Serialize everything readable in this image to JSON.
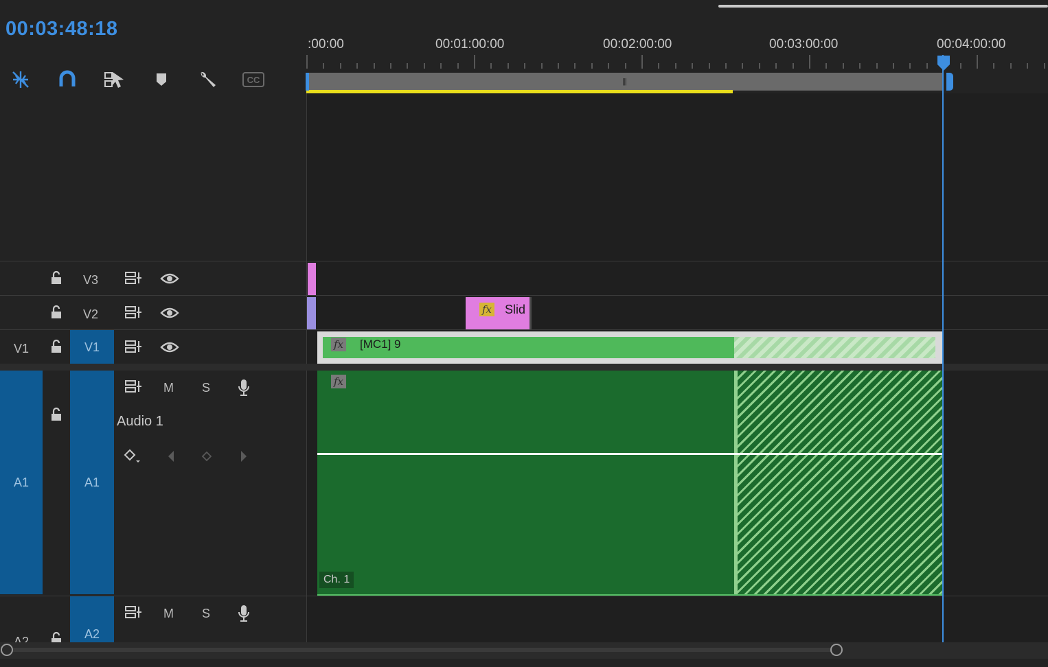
{
  "timecode": "00:03:48:18",
  "ruler": {
    "labels": [
      ":00:00",
      "00:01:00:00",
      "00:02:00:00",
      "00:03:00:00",
      "00:04:00:00"
    ]
  },
  "toolbar": {
    "icons": [
      "nest-sequence-icon",
      "snap-magnet-icon",
      "linked-selection-icon",
      "add-marker-icon",
      "timeline-settings-wrench-icon",
      "captions-cc-icon"
    ],
    "captions_label": "CC"
  },
  "tracks": {
    "v3": {
      "label": "V3"
    },
    "v2": {
      "label": "V2"
    },
    "v1": {
      "source": "V1",
      "label": "V1"
    },
    "a1": {
      "source": "A1",
      "label": "A1",
      "name": "Audio 1",
      "mute": "M",
      "solo": "S"
    },
    "a2": {
      "source": "A2",
      "label": "A2",
      "mute": "M",
      "solo": "S"
    }
  },
  "clips": {
    "v2_clip": {
      "label": "Slid",
      "fx": "fx",
      "color": "#e07de0"
    },
    "v1_clip": {
      "label": "[MC1] 9",
      "fx": "fx",
      "color": "#4fb95a"
    },
    "a1_clip": {
      "fx": "fx",
      "channel": "Ch. 1",
      "color": "#1b6b2d"
    }
  },
  "colors": {
    "accent": "#3d8ee0",
    "render_bar": "#e9dd1c",
    "track_target": "#0e5a93"
  }
}
